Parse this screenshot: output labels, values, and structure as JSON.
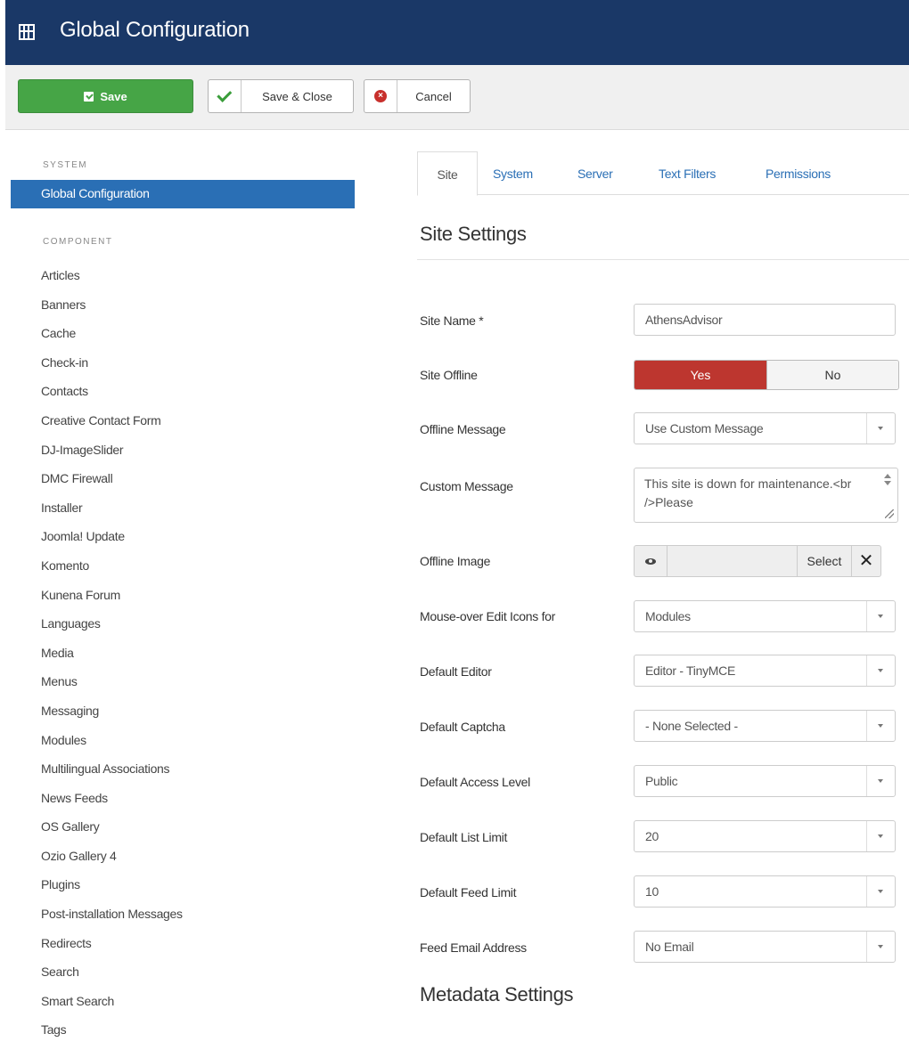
{
  "header": {
    "title": "Global Configuration",
    "icon": "config-grid-icon"
  },
  "toolbar": {
    "save_label": "Save",
    "save_close_label": "Save & Close",
    "cancel_label": "Cancel",
    "colors": {
      "save": "#46a546",
      "cancel_icon": "#c8302c"
    }
  },
  "sidebar": {
    "system_heading": "SYSTEM",
    "active_item": "Global Configuration",
    "component_heading": "COMPONENT",
    "items": [
      "Articles",
      "Banners",
      "Cache",
      "Check-in",
      "Contacts",
      "Creative Contact Form",
      "DJ-ImageSlider",
      "DMC Firewall",
      "Installer",
      "Joomla! Update",
      "Komento",
      "Kunena Forum",
      "Languages",
      "Media",
      "Menus",
      "Messaging",
      "Modules",
      "Multilingual Associations",
      "News Feeds",
      "OS Gallery",
      "Ozio Gallery 4",
      "Plugins",
      "Post-installation Messages",
      "Redirects",
      "Search",
      "Smart Search",
      "Tags"
    ]
  },
  "tabs": [
    {
      "label": "Site",
      "active": true
    },
    {
      "label": "System"
    },
    {
      "label": "Server"
    },
    {
      "label": "Text Filters"
    },
    {
      "label": "Permissions"
    }
  ],
  "site_settings": {
    "title": "Site Settings",
    "site_name": {
      "label": "Site Name *",
      "value": "AthensAdvisor"
    },
    "site_offline": {
      "label": "Site Offline",
      "yes": "Yes",
      "no": "No",
      "selected": "Yes"
    },
    "offline_message": {
      "label": "Offline Message",
      "value": "Use Custom Message"
    },
    "custom_message": {
      "label": "Custom Message",
      "value": "This site is down for maintenance.<br />Please"
    },
    "offline_image": {
      "label": "Offline Image",
      "select": "Select",
      "clear": "✕"
    },
    "edit_icons": {
      "label": "Mouse-over Edit Icons for",
      "value": "Modules"
    },
    "default_editor": {
      "label": "Default Editor",
      "value": "Editor - TinyMCE"
    },
    "default_captcha": {
      "label": "Default Captcha",
      "value": "- None Selected -"
    },
    "access_level": {
      "label": "Default Access Level",
      "value": "Public"
    },
    "list_limit": {
      "label": "Default List Limit",
      "value": "20"
    },
    "feed_limit": {
      "label": "Default Feed Limit",
      "value": "10"
    },
    "feed_email": {
      "label": "Feed Email Address",
      "value": "No Email"
    }
  },
  "metadata": {
    "title": "Metadata Settings"
  }
}
